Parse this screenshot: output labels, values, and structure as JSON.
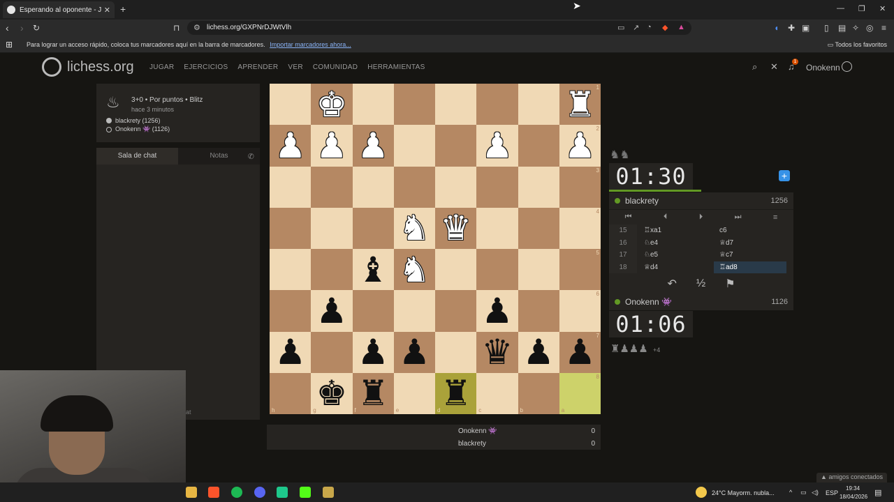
{
  "browser": {
    "tab_title": "Esperando al oponente - Jugar l",
    "tab_close": "✕",
    "new_tab": "+",
    "url": "lichess.org/GXPNrDJWtVlh",
    "bookmarks_hint": "Para lograr un acceso rápido, coloca tus marcadores aquí en la barra de marcadores.",
    "bookmarks_import": "Importar marcadores ahora...",
    "all_favorites": "Todos los favoritos"
  },
  "site": {
    "name": "lichess.org",
    "nav": [
      "JUGAR",
      "EJERCICIOS",
      "APRENDER",
      "VER",
      "COMUNIDAD",
      "HERRAMIENTAS"
    ],
    "notif_count": "1",
    "username": "Onokenn"
  },
  "game_info": {
    "mode": "3+0 • Por puntos • Blitz",
    "time_ago": "hace 3 minutos",
    "player_black": "blackrety (1256)",
    "player_white": "Onokenn 👾 (1126)"
  },
  "chat": {
    "tab_chat": "Sala de chat",
    "tab_notes": "Notas",
    "input_hint": "at"
  },
  "board": {
    "ranks": [
      "1",
      "2",
      "3",
      "4",
      "5",
      "6",
      "7",
      "8"
    ],
    "files": [
      "h",
      "g",
      "f",
      "e",
      "d",
      "c",
      "b",
      "a"
    ],
    "rows": [
      [
        "",
        "wK",
        "",
        "",
        "",
        "",
        "",
        "wR"
      ],
      [
        "wP",
        "wP",
        "wP",
        "",
        "",
        "wP",
        "",
        "wP"
      ],
      [
        "",
        "",
        "",
        "",
        "",
        "",
        "",
        ""
      ],
      [
        "",
        "",
        "",
        "wN",
        "wQ",
        "",
        "",
        ""
      ],
      [
        "",
        "",
        "bB",
        "wN",
        "",
        "",
        "",
        ""
      ],
      [
        "",
        "bP",
        "",
        "",
        "",
        "bP",
        "",
        ""
      ],
      [
        "bP",
        "",
        "bP",
        "bP",
        "",
        "bQ",
        "bP",
        "bP"
      ],
      [
        "",
        "bK",
        "bR",
        "",
        "bR",
        "",
        "",
        ""
      ]
    ],
    "highlight": [
      [
        7,
        4
      ],
      [
        7,
        7
      ]
    ]
  },
  "opponent": {
    "clock": "01:30",
    "name": "blackrety",
    "rating": "1256"
  },
  "me": {
    "clock": "01:06",
    "name": "Onokenn 👾",
    "rating": "1126",
    "material_plus": "+4"
  },
  "moves": [
    {
      "num": "15",
      "white": "♖xa1",
      "black": "c6"
    },
    {
      "num": "16",
      "white": "♘e4",
      "black": "♕d7"
    },
    {
      "num": "17",
      "white": "♘e5",
      "black": "♕c7"
    },
    {
      "num": "18",
      "white": "♕d4",
      "black": "♖ad8"
    }
  ],
  "round_table": [
    {
      "name": "Onokenn 👾",
      "score": "0"
    },
    {
      "name": "blackrety",
      "score": "0"
    }
  ],
  "taskbar": {
    "friends": "▲ amigos conectados",
    "weather": "24°C  Mayorm. nubla...",
    "lang": "ESP",
    "time": "19:34",
    "date": "18/04/2026"
  }
}
